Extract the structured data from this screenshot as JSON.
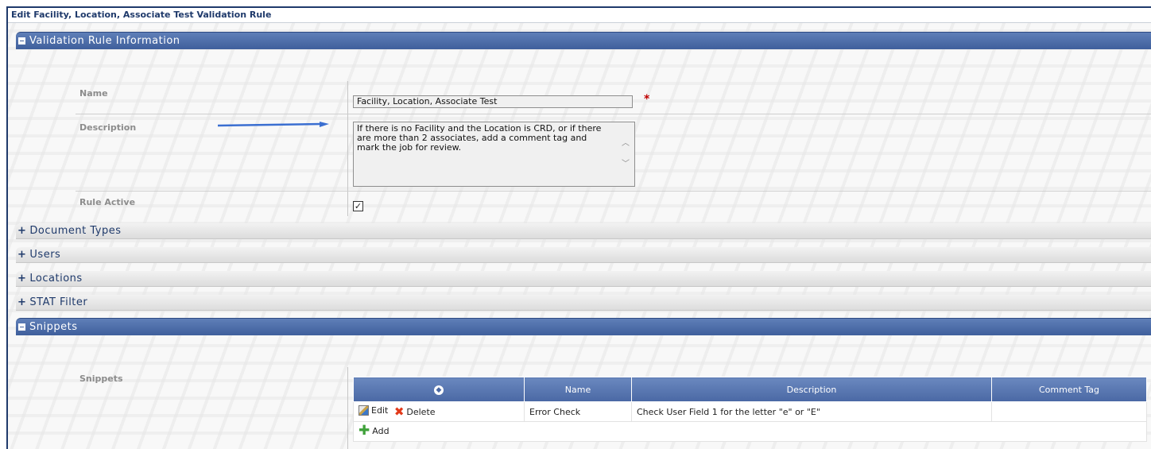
{
  "window_title": "Edit Facility, Location, Associate Test Validation Rule",
  "sections": {
    "validation": {
      "label": "Validation Rule Information",
      "expanded": true
    },
    "document_types": {
      "label": "Document Types",
      "expanded": false
    },
    "users": {
      "label": "Users",
      "expanded": false
    },
    "locations": {
      "label": "Locations",
      "expanded": false
    },
    "stat_filter": {
      "label": "STAT Filter",
      "expanded": false
    },
    "snippets": {
      "label": "Snippets",
      "expanded": true
    }
  },
  "form": {
    "name_label": "Name",
    "name_value": "Facility, Location, Associate Test",
    "required_marker": "*",
    "description_label": "Description",
    "description_value": "If there is no Facility and the Location is CRD, or if there are more than 2 associates, add a comment tag and mark the job for review.",
    "rule_active_label": "Rule Active",
    "rule_active_checked": true,
    "rule_active_mark": "✓"
  },
  "snippets": {
    "label": "Snippets",
    "columns": [
      "Name",
      "Description",
      "Comment Tag"
    ],
    "sort_icon": "sort-icon",
    "rows": [
      {
        "edit_label": "Edit",
        "delete_label": "Delete",
        "name": "Error Check",
        "description": "Check User Field 1 for the letter \"e\" or \"E\"",
        "comment_tag": ""
      }
    ],
    "add_label": "Add"
  },
  "colors": {
    "section_header": "#4a68a4",
    "required": "#c00000",
    "arrow": "#3b6fd1"
  }
}
